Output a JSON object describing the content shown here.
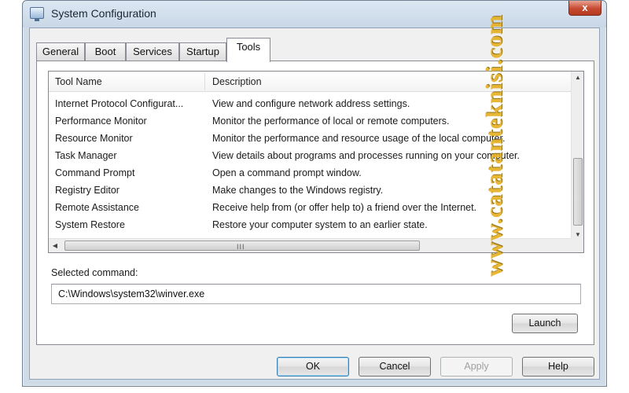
{
  "window": {
    "title": "System Configuration",
    "close_label": "x"
  },
  "tabs": [
    {
      "label": "General"
    },
    {
      "label": "Boot"
    },
    {
      "label": "Services"
    },
    {
      "label": "Startup"
    },
    {
      "label": "Tools",
      "active": true
    }
  ],
  "tools_list": {
    "columns": [
      "Tool Name",
      "Description"
    ],
    "rows": [
      {
        "name": "Internet Protocol Configurat...",
        "description": "View and configure network address settings."
      },
      {
        "name": "Performance Monitor",
        "description": "Monitor the performance of local or remote computers."
      },
      {
        "name": "Resource Monitor",
        "description": "Monitor the performance and resource usage of the local computer."
      },
      {
        "name": "Task Manager",
        "description": "View details about programs and processes running on your computer."
      },
      {
        "name": "Command Prompt",
        "description": "Open a command prompt window."
      },
      {
        "name": "Registry Editor",
        "description": "Make changes to the Windows registry."
      },
      {
        "name": "Remote Assistance",
        "description": "Receive help from (or offer help to) a friend over the Internet."
      },
      {
        "name": "System Restore",
        "description": "Restore your computer system to an earlier state."
      }
    ],
    "scroll_grip": "III"
  },
  "selected_command": {
    "label": "Selected command:",
    "value": "C:\\Windows\\system32\\winver.exe"
  },
  "buttons": {
    "launch": "Launch",
    "ok": "OK",
    "cancel": "Cancel",
    "apply": "Apply",
    "help": "Help"
  },
  "watermark": "www.catatanteknisi.com",
  "colors": {
    "frame": "#cfdbe7",
    "close_button": "#c64a2f",
    "watermark": "#e6b126"
  }
}
